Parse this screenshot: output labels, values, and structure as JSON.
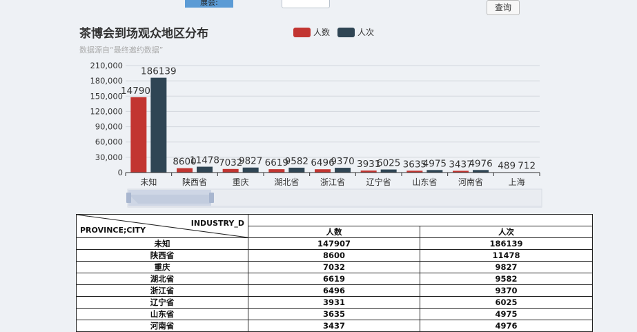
{
  "filter": {
    "label": "展会:",
    "query_button": "查询"
  },
  "chart_data": {
    "type": "bar",
    "title": "茶博会到场观众地区分布",
    "subtitle": "数据源自“最终邀约数据”",
    "categories": [
      "未知",
      "陕西省",
      "重庆",
      "湖北省",
      "浙江省",
      "辽宁省",
      "山东省",
      "河南省",
      "上海"
    ],
    "series": [
      {
        "name": "人数",
        "values": [
          147907,
          8600,
          7032,
          6619,
          6496,
          3931,
          3635,
          3437,
          489
        ],
        "color": "#c23531"
      },
      {
        "name": "人次",
        "values": [
          186139,
          11478,
          9827,
          9582,
          9370,
          6025,
          4975,
          4976,
          712
        ],
        "color": "#2f4554"
      }
    ],
    "y_ticks": [
      "0",
      "30,000",
      "60,000",
      "90,000",
      "120,000",
      "150,000",
      "180,000",
      "210,000"
    ],
    "ylim": [
      0,
      210000
    ],
    "grid": true,
    "legend_position": "top-center"
  },
  "table": {
    "corner_row_field": "PROVINCE;CITY",
    "corner_col_field": "INDUSTRY_D",
    "columns": [
      "人数",
      "人次"
    ],
    "rows": [
      {
        "name": "未知",
        "people": "147907",
        "visits": "186139"
      },
      {
        "name": "陕西省",
        "people": "8600",
        "visits": "11478"
      },
      {
        "name": "重庆",
        "people": "7032",
        "visits": "9827"
      },
      {
        "name": "湖北省",
        "people": "6619",
        "visits": "9582"
      },
      {
        "name": "浙江省",
        "people": "6496",
        "visits": "9370"
      },
      {
        "name": "辽宁省",
        "people": "3931",
        "visits": "6025"
      },
      {
        "name": "山东省",
        "people": "3635",
        "visits": "4975"
      },
      {
        "name": "河南省",
        "people": "3437",
        "visits": "4976"
      }
    ]
  }
}
